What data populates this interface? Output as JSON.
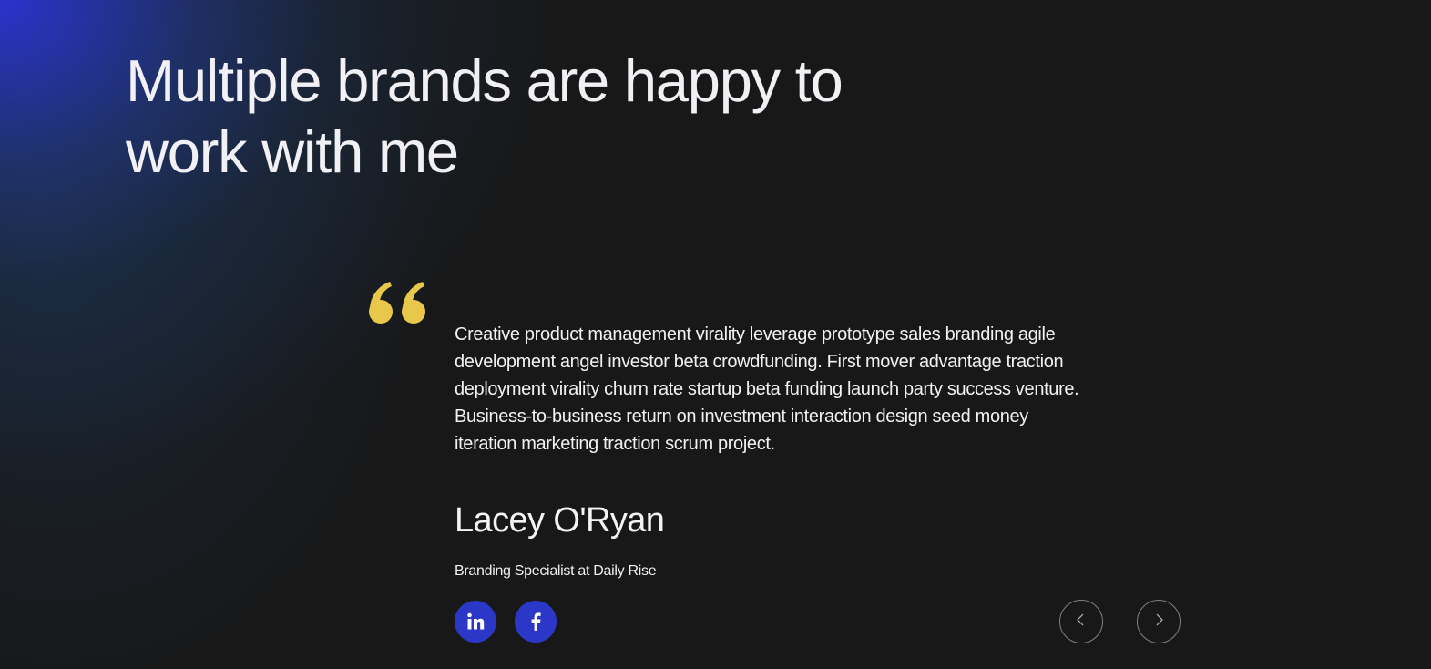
{
  "section": {
    "headline": "Multiple brands are happy to work with me"
  },
  "testimonial": {
    "quote": "Creative product management virality leverage prototype sales branding agile development angel investor beta crowdfunding. First mover advantage traction deployment virality churn rate startup beta funding launch party success venture. Business-to-business return on investment interaction design seed money iteration marketing traction scrum project.",
    "author_name": "Lacey O'Ryan",
    "author_role": "Branding Specialist at Daily Rise",
    "quote_mark_color": "#e8c84a"
  },
  "social_links": [
    {
      "icon": "linkedin-icon",
      "glyph": "in"
    },
    {
      "icon": "facebook-icon",
      "glyph": "f"
    }
  ],
  "colors": {
    "background": "#181818",
    "accent_blue": "#2b38c7",
    "text": "#f2f2f2"
  },
  "navigation": {
    "prev_icon": "chevron-left-icon",
    "next_icon": "chevron-right-icon"
  }
}
